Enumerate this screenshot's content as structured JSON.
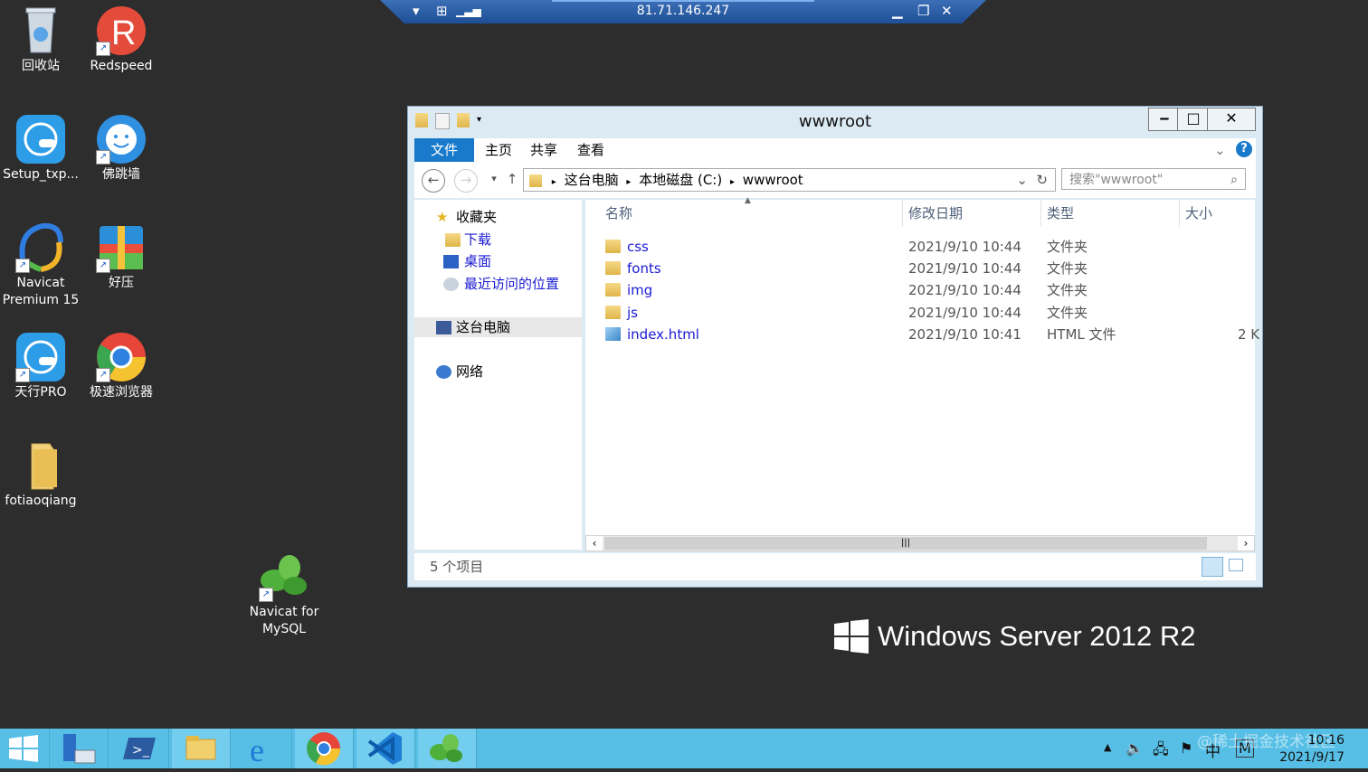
{
  "rdp": {
    "host": "81.71.146.247"
  },
  "desktop_icons": [
    {
      "label": "回收站",
      "icon": "recycle-bin-icon"
    },
    {
      "label": "Redspeed",
      "icon": "redspeed-icon"
    },
    {
      "label": "Setup_txp...",
      "icon": "setup-txp-icon"
    },
    {
      "label": "佛跳墙",
      "icon": "buddha-icon"
    },
    {
      "label": "Navicat Premium 15",
      "icon": "navicat-premium-icon"
    },
    {
      "label": "好压",
      "icon": "haozip-icon"
    },
    {
      "label": "天行PRO",
      "icon": "tianxing-pro-icon"
    },
    {
      "label": "极速浏览器",
      "icon": "browser-icon"
    },
    {
      "label": "fotiaoqiang",
      "icon": "folder-icon"
    },
    {
      "label": "Navicat for MySQL",
      "icon": "navicat-mysql-icon"
    }
  ],
  "explorer": {
    "title": "wwwroot",
    "tabs": [
      "文件",
      "主页",
      "共享",
      "查看"
    ],
    "breadcrumb": [
      "这台电脑",
      "本地磁盘 (C:)",
      "wwwroot"
    ],
    "search_placeholder": "搜索\"wwwroot\"",
    "nav": {
      "favorites": "收藏夹",
      "downloads": "下载",
      "desktop": "桌面",
      "recent": "最近访问的位置",
      "this_pc": "这台电脑",
      "network": "网络"
    },
    "columns": [
      "名称",
      "修改日期",
      "类型",
      "大小"
    ],
    "files": [
      {
        "name": "css",
        "date": "2021/9/10 10:44",
        "type": "文件夹",
        "size": ""
      },
      {
        "name": "fonts",
        "date": "2021/9/10 10:44",
        "type": "文件夹",
        "size": ""
      },
      {
        "name": "img",
        "date": "2021/9/10 10:44",
        "type": "文件夹",
        "size": ""
      },
      {
        "name": "js",
        "date": "2021/9/10 10:44",
        "type": "文件夹",
        "size": ""
      },
      {
        "name": "index.html",
        "date": "2021/9/10 10:41",
        "type": "HTML 文件",
        "size": "2 K"
      }
    ],
    "status": "5 个项目"
  },
  "os_brand": "Windows Server 2012 R2",
  "tray": {
    "time": "10:16",
    "date": "2021/9/17",
    "ime": "中",
    "ime2": "M",
    "watermark": "@稀土掘金技术社区"
  }
}
